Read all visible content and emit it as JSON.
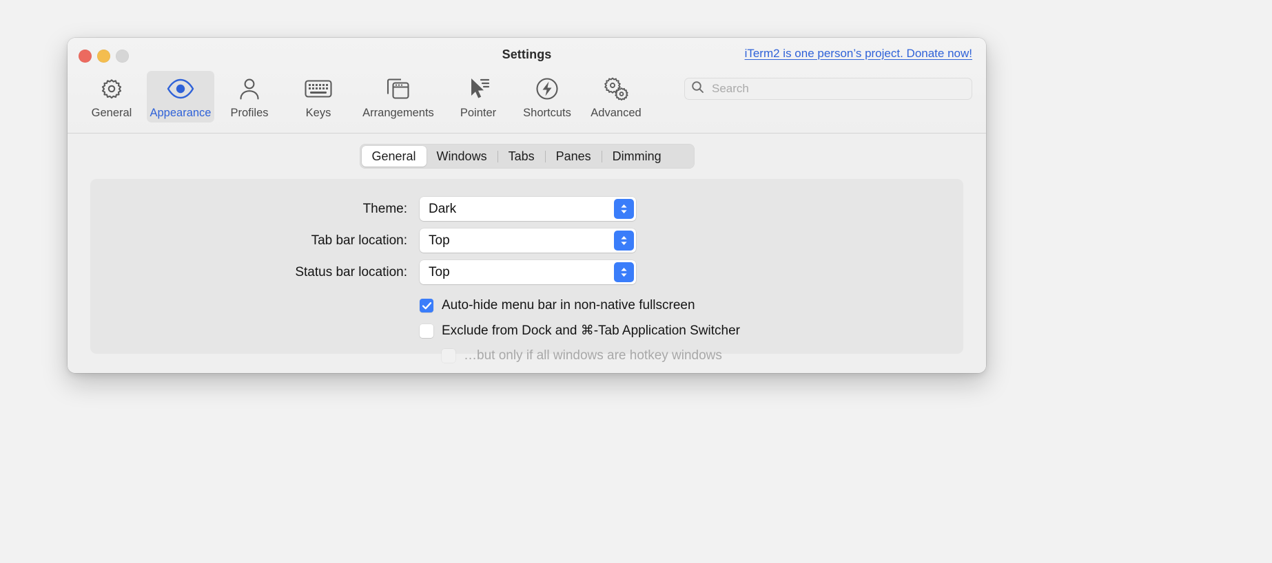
{
  "window": {
    "title": "Settings",
    "donate_link": "iTerm2 is one person’s project. Donate now!",
    "traffic_lights": {
      "close": "close",
      "minimize": "minimize",
      "zoom": "zoom"
    }
  },
  "search": {
    "placeholder": "Search",
    "value": ""
  },
  "toolbar": {
    "items": [
      {
        "label": "General",
        "icon": "gear-icon",
        "selected": false
      },
      {
        "label": "Appearance",
        "icon": "eye-icon",
        "selected": true
      },
      {
        "label": "Profiles",
        "icon": "person-icon",
        "selected": false
      },
      {
        "label": "Keys",
        "icon": "keyboard-icon",
        "selected": false
      },
      {
        "label": "Arrangements",
        "icon": "windows-icon",
        "selected": false
      },
      {
        "label": "Pointer",
        "icon": "cursor-icon",
        "selected": false
      },
      {
        "label": "Shortcuts",
        "icon": "bolt-circle-icon",
        "selected": false
      },
      {
        "label": "Advanced",
        "icon": "double-gear-icon",
        "selected": false
      }
    ]
  },
  "segmented_tabs": {
    "items": [
      "General",
      "Windows",
      "Tabs",
      "Panes",
      "Dimming"
    ],
    "selected": "General"
  },
  "form": {
    "rows": [
      {
        "label": "Theme:",
        "value": "Dark"
      },
      {
        "label": "Tab bar location:",
        "value": "Top"
      },
      {
        "label": "Status bar location:",
        "value": "Top"
      }
    ]
  },
  "checkboxes": [
    {
      "label": "Auto-hide menu bar in non-native fullscreen",
      "checked": true,
      "disabled": false,
      "indented": false
    },
    {
      "label": "Exclude from Dock and ⌘-Tab Application Switcher",
      "checked": false,
      "disabled": false,
      "indented": false
    },
    {
      "label": "…but only if all windows are hotkey windows",
      "checked": false,
      "disabled": true,
      "indented": true
    }
  ],
  "colors": {
    "accent_blue": "#3a7dfa",
    "link_blue": "#2f62d8",
    "close_red": "#ec6a5f",
    "minimize_yellow": "#f4bd4f",
    "zoom_gray": "#d6d6d6"
  }
}
